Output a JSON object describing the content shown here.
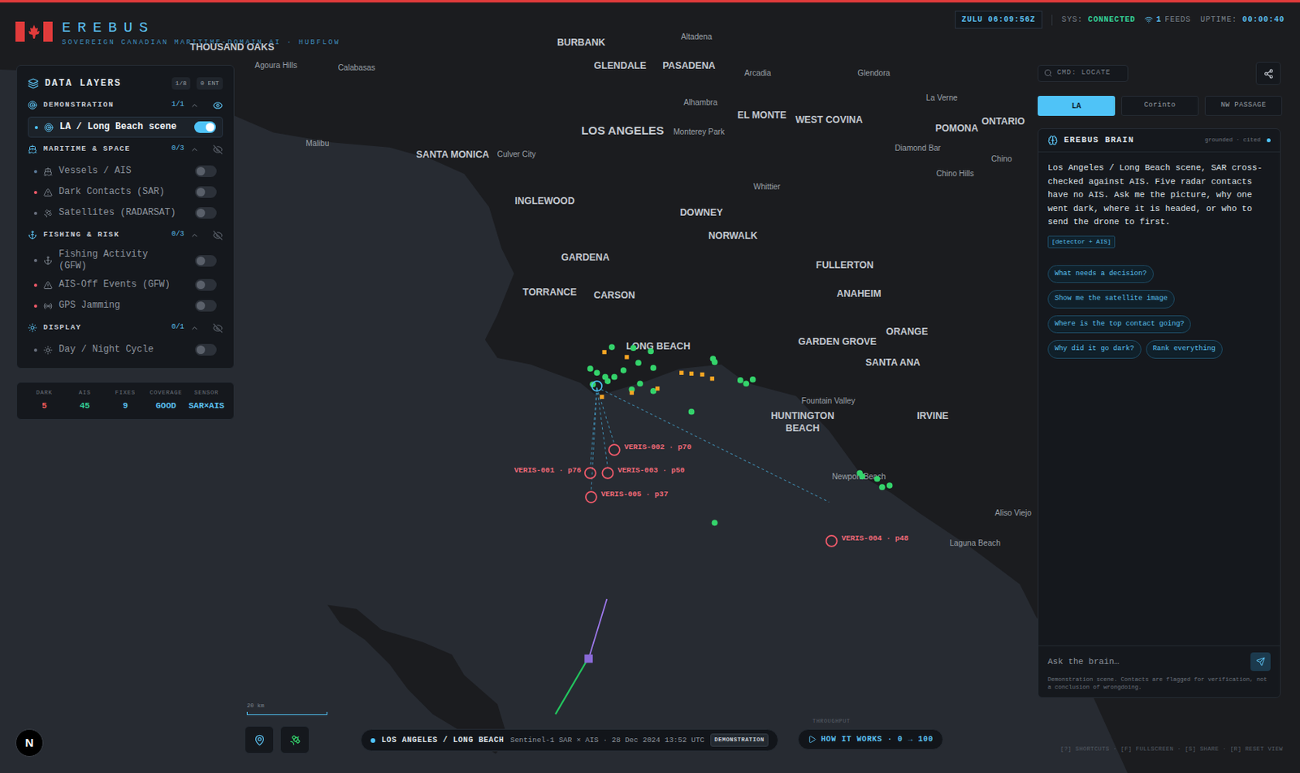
{
  "header": {
    "brand": "EREBUS",
    "subtitle": "SOVEREIGN CANADIAN MARITIME-DOMAIN AI · HUBFLOW",
    "zulu": "ZULU 06:09:56Z",
    "sys_label": "SYS:",
    "sys_value": "CONNECTED",
    "feeds_count": "1",
    "feeds_label": "FEEDS",
    "uptime_label": "UPTIME:",
    "uptime_value": "00:00:40"
  },
  "layers": {
    "title": "DATA LAYERS",
    "count": "1/8",
    "entities": "0 ENT",
    "groups": [
      {
        "name": "DEMONSTRATION",
        "count": "1/1",
        "expanded": true,
        "visible": true,
        "items": [
          {
            "label": "LA / Long Beach scene",
            "on": true,
            "color": "#4fc3f7"
          }
        ]
      },
      {
        "name": "MARITIME & SPACE",
        "count": "0/3",
        "expanded": true,
        "visible": false,
        "items": [
          {
            "label": "Vessels / AIS",
            "on": false,
            "color": "#5b7a99"
          },
          {
            "label": "Dark Contacts (SAR)",
            "on": false,
            "color": "#f05a6a"
          },
          {
            "label": "Satellites (RADARSAT)",
            "on": false,
            "color": "#6b7280"
          }
        ]
      },
      {
        "name": "FISHING & RISK",
        "count": "0/3",
        "expanded": true,
        "visible": false,
        "items": [
          {
            "label": "Fishing Activity (GFW)",
            "on": false,
            "color": "#6b7280"
          },
          {
            "label": "AIS-Off Events (GFW)",
            "on": false,
            "color": "#f05a6a"
          },
          {
            "label": "GPS Jamming",
            "on": false,
            "color": "#f05a6a"
          }
        ]
      },
      {
        "name": "DISPLAY",
        "count": "0/1",
        "expanded": true,
        "visible": false,
        "items": [
          {
            "label": "Day / Night Cycle",
            "on": false,
            "color": "#6b7280"
          }
        ]
      }
    ]
  },
  "stats": [
    {
      "label": "DARK",
      "value": "5",
      "color": "#f05a5a"
    },
    {
      "label": "AIS",
      "value": "45",
      "color": "#34d399"
    },
    {
      "label": "FIXES",
      "value": "9",
      "color": "#5bc0f0"
    },
    {
      "label": "COVERAGE",
      "value": "GOOD",
      "color": "#5bc0f0"
    },
    {
      "label": "SENSOR",
      "value": "SAR×AIS",
      "color": "#5bc0f0"
    }
  ],
  "command": {
    "placeholder": "CMD: LOCATE"
  },
  "scenes": [
    {
      "label": "LA",
      "selected": true
    },
    {
      "label": "Corinto",
      "selected": false
    },
    {
      "label": "NW PASSAGE",
      "selected": false
    }
  ],
  "brain": {
    "title": "EREBUS BRAIN",
    "status": "grounded · cited",
    "message": "Los Angeles / Long Beach scene, SAR cross-checked against AIS. Five radar contacts have no AIS. Ask me the picture, why one went dark, where it is headed, or who to send the drone to first.",
    "source": "[detector + AIS]",
    "suggestions": [
      "What needs a decision?",
      "Show me the satellite image",
      "Where is the top contact going?",
      "Why did it go dark?",
      "Rank everything"
    ],
    "placeholder": "Ask the brain…",
    "disclaimer": "Demonstration scene. Contacts are flagged for verification, not a conclusion of wrongdoing."
  },
  "map": {
    "labels": [
      {
        "text": "THOUSAND OAKS",
        "kind": "major"
      },
      {
        "text": "BURBANK",
        "kind": "major"
      },
      {
        "text": "Altadena",
        "kind": "minor"
      },
      {
        "text": "GLENDALE",
        "kind": "major"
      },
      {
        "text": "PASADENA",
        "kind": "major"
      },
      {
        "text": "Calabasas",
        "kind": "minor"
      },
      {
        "text": "Agoura Hills",
        "kind": "minor"
      },
      {
        "text": "Arcadia",
        "kind": "minor"
      },
      {
        "text": "Glendora",
        "kind": "minor"
      },
      {
        "text": "Alhambra",
        "kind": "minor"
      },
      {
        "text": "EL MONTE",
        "kind": "major"
      },
      {
        "text": "WEST COVINA",
        "kind": "major"
      },
      {
        "text": "La Verne",
        "kind": "minor"
      },
      {
        "text": "POMONA",
        "kind": "major"
      },
      {
        "text": "ONTARIO",
        "kind": "major"
      },
      {
        "text": "LOS ANGELES",
        "kind": "capital"
      },
      {
        "text": "Monterey Park",
        "kind": "minor"
      },
      {
        "text": "Malibu",
        "kind": "minor"
      },
      {
        "text": "SANTA MONICA",
        "kind": "major"
      },
      {
        "text": "Culver City",
        "kind": "minor"
      },
      {
        "text": "Diamond Bar",
        "kind": "minor"
      },
      {
        "text": "Chino",
        "kind": "minor"
      },
      {
        "text": "Chino Hills",
        "kind": "minor"
      },
      {
        "text": "Whittier",
        "kind": "minor"
      },
      {
        "text": "INGLEWOOD",
        "kind": "major"
      },
      {
        "text": "DOWNEY",
        "kind": "major"
      },
      {
        "text": "NORWALK",
        "kind": "major"
      },
      {
        "text": "GARDENA",
        "kind": "major"
      },
      {
        "text": "FULLERTON",
        "kind": "major"
      },
      {
        "text": "TORRANCE",
        "kind": "major"
      },
      {
        "text": "CARSON",
        "kind": "major"
      },
      {
        "text": "ANAHEIM",
        "kind": "major"
      },
      {
        "text": "ORANGE",
        "kind": "major"
      },
      {
        "text": "GARDEN GROVE",
        "kind": "major"
      },
      {
        "text": "LONG BEACH",
        "kind": "major"
      },
      {
        "text": "SANTA ANA",
        "kind": "major"
      },
      {
        "text": "Fountain Valley",
        "kind": "minor"
      },
      {
        "text": "HUNTINGTON",
        "kind": "major"
      },
      {
        "text": "BEACH",
        "kind": "major"
      },
      {
        "text": "IRVINE",
        "kind": "major"
      },
      {
        "text": "Newport Beach",
        "kind": "minor"
      },
      {
        "text": "Aliso Viejo",
        "kind": "minor"
      },
      {
        "text": "Laguna Beach",
        "kind": "minor"
      }
    ],
    "contacts": [
      {
        "label": "VERIS-002 · p70"
      },
      {
        "label": "VERIS-001 · p76"
      },
      {
        "label": "VERIS-003 · p50"
      },
      {
        "label": "VERIS-005 · p37"
      },
      {
        "label": "VERIS-004 · p48"
      }
    ],
    "scale": "20 km"
  },
  "status_bar": {
    "place": "LOS ANGELES / LONG BEACH",
    "source": "Sentinel-1 SAR × AIS · 28 Dec 2024 13:52 UTC",
    "badge": "DEMONSTRATION",
    "throughput": "THROUGHPUT",
    "how": "HOW IT WORKS · 0 → 100",
    "logo": "N"
  },
  "shortcuts": "[?] SHORTCUTS · [F] FULLSCREEN · [S] SHARE · [R] RESET VIEW"
}
